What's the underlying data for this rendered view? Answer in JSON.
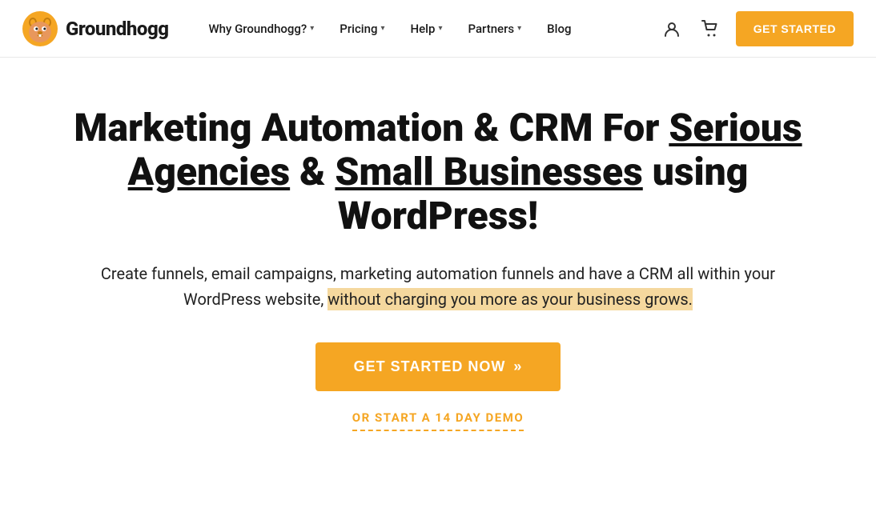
{
  "brand": {
    "name": "Groundhogg",
    "logo_alt": "Groundhogg logo"
  },
  "nav": {
    "links": [
      {
        "label": "Why Groundhogg?",
        "has_dropdown": true
      },
      {
        "label": "Pricing",
        "has_dropdown": true
      },
      {
        "label": "Help",
        "has_dropdown": true
      },
      {
        "label": "Partners",
        "has_dropdown": true
      },
      {
        "label": "Blog",
        "has_dropdown": false
      }
    ],
    "cta_label": "GET STARTED"
  },
  "hero": {
    "title_part1": "Marketing Automation & CRM For ",
    "title_highlight1": "Serious Agencies",
    "title_part2": " & ",
    "title_highlight2": "Small Businesses",
    "title_part3": " using WordPress!",
    "subtitle_part1": "Create funnels, email campaigns, marketing automation funnels and have a CRM all within your WordPress website, ",
    "subtitle_highlight": "without charging you more as your business grows.",
    "cta_primary_label": "GET STARTED NOW",
    "cta_primary_chevrons": "»",
    "cta_secondary_label": "OR START A 14 DAY DEMO"
  },
  "colors": {
    "orange": "#f5a623",
    "dark": "#111111",
    "highlight_bg": "#f5d89e"
  }
}
